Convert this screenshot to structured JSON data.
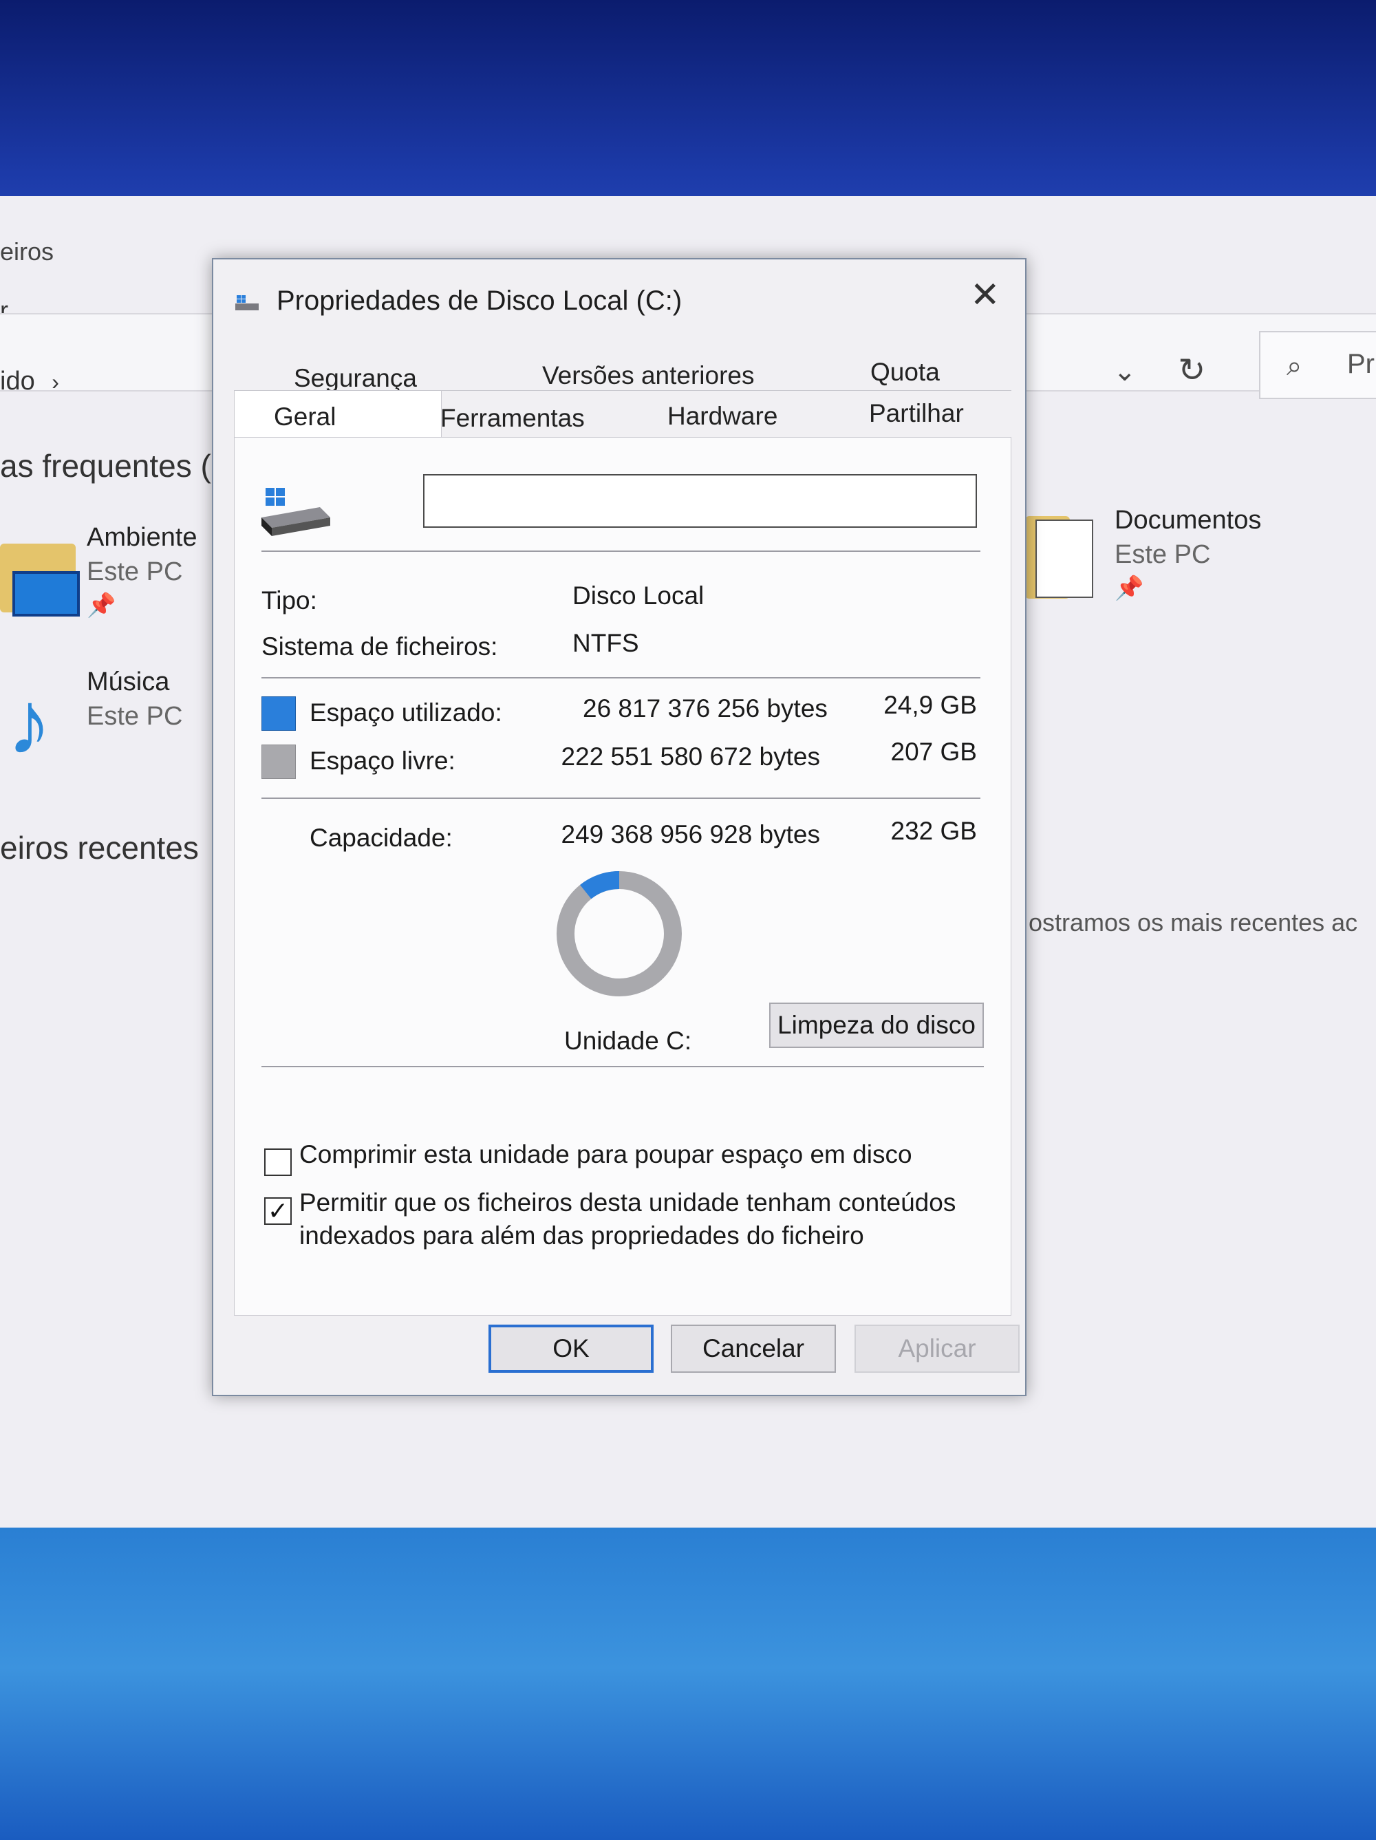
{
  "explorer": {
    "title_fragment": "eiros",
    "menu_fragment": "r",
    "path_fragment": "ido",
    "path_chevron": "›",
    "search_fragment": "Pr",
    "frequent_header": "as frequentes (",
    "recent_header": "eiros recentes",
    "recent_note": "ostramos os mais recentes ac",
    "quick_access": [
      {
        "name": "Ambiente",
        "location": "Este PC",
        "icon": "desktop-folder-icon"
      },
      {
        "name": "Música",
        "location": "Este PC",
        "icon": "music-folder-icon"
      },
      {
        "name": "Documentos",
        "location": "Este PC",
        "icon": "documents-folder-icon"
      }
    ]
  },
  "dialog": {
    "title": "Propriedades de Disco Local (C:)",
    "tabs_row1": [
      "Segurança",
      "Versões anteriores",
      "Quota"
    ],
    "tabs_row2": [
      "Geral",
      "Ferramentas",
      "Hardware",
      "Partilhar"
    ],
    "active_tab": "Geral",
    "drive_name_value": "",
    "type_label": "Tipo:",
    "type_value": "Disco Local",
    "fs_label": "Sistema de ficheiros:",
    "fs_value": "NTFS",
    "used_label": "Espaço utilizado:",
    "used_bytes": "26 817 376 256 bytes",
    "used_size": "24,9 GB",
    "free_label": "Espaço livre:",
    "free_bytes": "222 551 580 672 bytes",
    "free_size": "207 GB",
    "capacity_label": "Capacidade:",
    "capacity_bytes": "249 368 956 928 bytes",
    "capacity_size": "232 GB",
    "drive_label": "Unidade C:",
    "cleanup_button": "Limpeza do disco",
    "compress_label": "Comprimir esta unidade para poupar espaço em disco",
    "compress_checked": false,
    "index_label_line1": "Permitir que os ficheiros desta unidade tenham conteúdos",
    "index_label_line2": "indexados para além das propriedades do ficheiro",
    "index_checked": true,
    "ok_button": "OK",
    "cancel_button": "Cancelar",
    "apply_button": "Aplicar",
    "close_glyph": "✕",
    "check_glyph": "✓",
    "used_fraction": 0.1075,
    "colors": {
      "used": "#2a7fdb",
      "free": "#a9a9ad",
      "accent": "#2a6fd1"
    }
  }
}
